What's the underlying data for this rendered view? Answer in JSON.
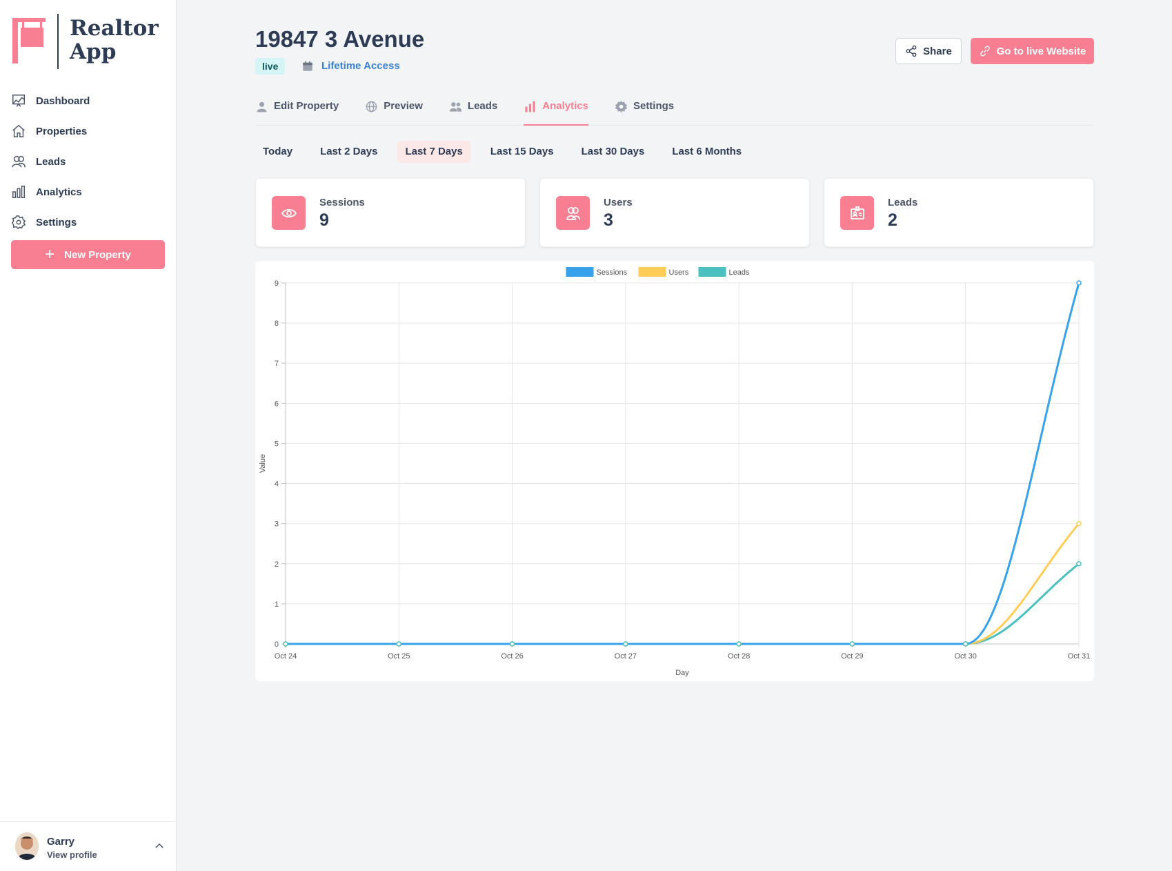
{
  "sidebar": {
    "logo_line1": "Realtor",
    "logo_line2": "App",
    "nav": [
      {
        "label": "Dashboard",
        "icon": "chart-line-icon"
      },
      {
        "label": "Properties",
        "icon": "home-icon"
      },
      {
        "label": "Leads",
        "icon": "users-icon"
      },
      {
        "label": "Analytics",
        "icon": "bar-chart-icon"
      },
      {
        "label": "Settings",
        "icon": "gear-icon"
      }
    ],
    "new_button": "New Property",
    "profile": {
      "name": "Garry",
      "link": "View profile"
    }
  },
  "header": {
    "title": "19847 3 Avenue",
    "status_badge": "live",
    "access_label": "Lifetime Access",
    "share_label": "Share",
    "live_site_label": "Go to live Website"
  },
  "tabs": [
    {
      "label": "Edit Property",
      "icon": "user-icon",
      "active": false
    },
    {
      "label": "Preview",
      "icon": "globe-icon",
      "active": false
    },
    {
      "label": "Leads",
      "icon": "users-icon",
      "active": false
    },
    {
      "label": "Analytics",
      "icon": "bar-chart-icon",
      "active": true
    },
    {
      "label": "Settings",
      "icon": "gear-icon",
      "active": false
    }
  ],
  "ranges": [
    {
      "label": "Today",
      "active": false
    },
    {
      "label": "Last 2 Days",
      "active": false
    },
    {
      "label": "Last 7 Days",
      "active": true
    },
    {
      "label": "Last 15 Days",
      "active": false
    },
    {
      "label": "Last 30 Days",
      "active": false
    },
    {
      "label": "Last 6 Months",
      "active": false
    }
  ],
  "stats": [
    {
      "label": "Sessions",
      "value": "9",
      "icon": "eye-icon"
    },
    {
      "label": "Users",
      "value": "3",
      "icon": "users-icon"
    },
    {
      "label": "Leads",
      "value": "2",
      "icon": "id-card-icon"
    }
  ],
  "colors": {
    "accent": "#f87f92",
    "sessions": "#36a2eb",
    "users": "#ffcd56",
    "leads": "#4bc0c0"
  },
  "chart_data": {
    "type": "line",
    "x": [
      "Oct 24",
      "Oct 25",
      "Oct 26",
      "Oct 27",
      "Oct 28",
      "Oct 29",
      "Oct 30",
      "Oct 31"
    ],
    "series": [
      {
        "name": "Sessions",
        "values": [
          0,
          0,
          0,
          0,
          0,
          0,
          0,
          9
        ],
        "color": "#36a2eb"
      },
      {
        "name": "Users",
        "values": [
          0,
          0,
          0,
          0,
          0,
          0,
          0,
          3
        ],
        "color": "#ffcd56"
      },
      {
        "name": "Leads",
        "values": [
          0,
          0,
          0,
          0,
          0,
          0,
          0,
          2
        ],
        "color": "#4bc0c0"
      }
    ],
    "xlabel": "Day",
    "ylabel": "Value",
    "ylim": [
      0,
      9
    ],
    "yticks": [
      0,
      1,
      2,
      3,
      4,
      5,
      6,
      7,
      8,
      9
    ],
    "legend": "top",
    "grid": true
  }
}
